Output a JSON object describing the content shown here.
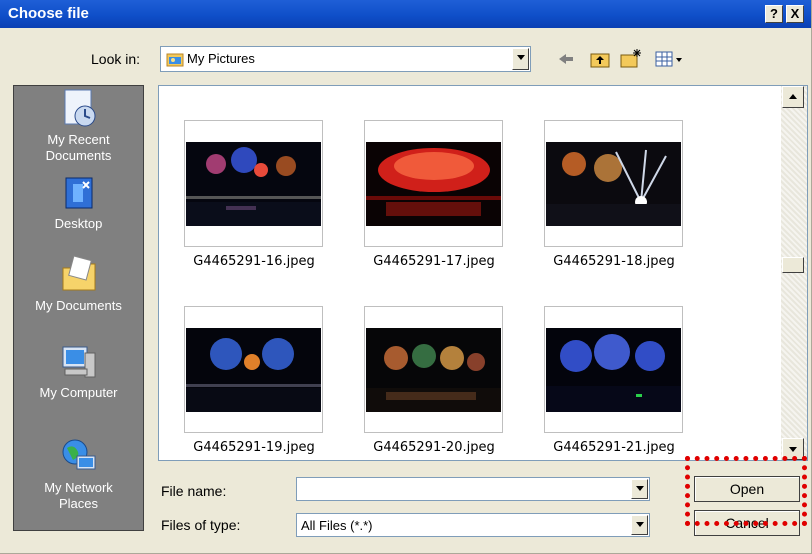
{
  "window": {
    "title": "Choose file",
    "help_btn": "?",
    "close_btn": "X"
  },
  "toolbar": {
    "look_in_label": "Look in:",
    "look_in_value": "My Pictures"
  },
  "places": [
    {
      "label": "My Recent Documents"
    },
    {
      "label": "Desktop"
    },
    {
      "label": "My Documents"
    },
    {
      "label": "My Computer"
    },
    {
      "label": "My Network Places"
    }
  ],
  "files": [
    {
      "name": "G4465291-16.jpeg"
    },
    {
      "name": "G4465291-17.jpeg"
    },
    {
      "name": "G4465291-18.jpeg"
    },
    {
      "name": "G4465291-19.jpeg"
    },
    {
      "name": "G4465291-20.jpeg"
    },
    {
      "name": "G4465291-21.jpeg"
    }
  ],
  "form": {
    "file_name_label": "File name:",
    "file_name_value": "",
    "file_type_label": "Files of type:",
    "file_type_value": "All Files (*.*)"
  },
  "buttons": {
    "open": "Open",
    "cancel": "Cancel"
  },
  "colors": {
    "titlebar": "#0f4fc9",
    "highlight": "#e00000",
    "dialog_bg": "#ece9d8"
  }
}
